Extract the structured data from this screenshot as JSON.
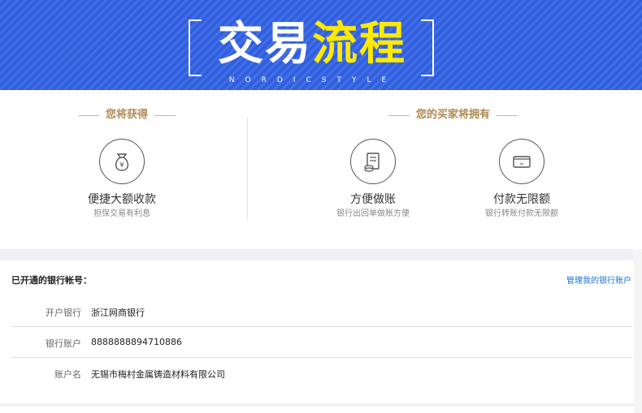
{
  "banner": {
    "title_white": "交易",
    "title_yellow": "流程",
    "subtitle": "NORDICSTYLE",
    "bg_color": "#2f5fe0",
    "highlight_color": "#ffea00"
  },
  "benefits": {
    "you_get": {
      "title": "您将获得",
      "items": [
        {
          "icon": "money-bag-icon",
          "title": "便捷大额收款",
          "subtitle": "担保交易有利息"
        }
      ]
    },
    "buyer_has": {
      "title": "您的买家将拥有",
      "items": [
        {
          "icon": "receipt-icon",
          "title": "方便做账",
          "subtitle": "银行出回单做账方便"
        },
        {
          "icon": "credit-card-icon",
          "title": "付款无限额",
          "subtitle": "银行转账付款无限额"
        }
      ]
    }
  },
  "bank": {
    "heading": "已开通的银行帐号：",
    "manage_link": "管理我的银行账户",
    "rows": [
      {
        "label": "开户银行",
        "value": "浙江网商银行"
      },
      {
        "label": "银行账户",
        "value": "8888888894710886"
      },
      {
        "label": "账户名",
        "value": "无锡市梅村金属铸造材料有限公司"
      }
    ]
  }
}
